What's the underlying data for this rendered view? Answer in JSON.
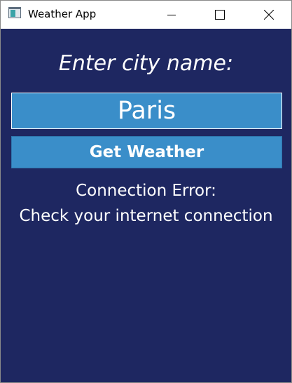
{
  "window": {
    "title": "Weather App",
    "controls": {
      "minimize_icon": "minimize-icon",
      "maximize_icon": "maximize-icon",
      "close_icon": "close-icon"
    }
  },
  "main": {
    "prompt": "Enter city name:",
    "city_input_value": "Paris",
    "button_label": "Get Weather",
    "status_line1": "Connection Error:",
    "status_line2": "Check your internet connection"
  },
  "colors": {
    "background": "#1e2761",
    "accent": "#3a8ec9",
    "text": "#ffffff"
  }
}
